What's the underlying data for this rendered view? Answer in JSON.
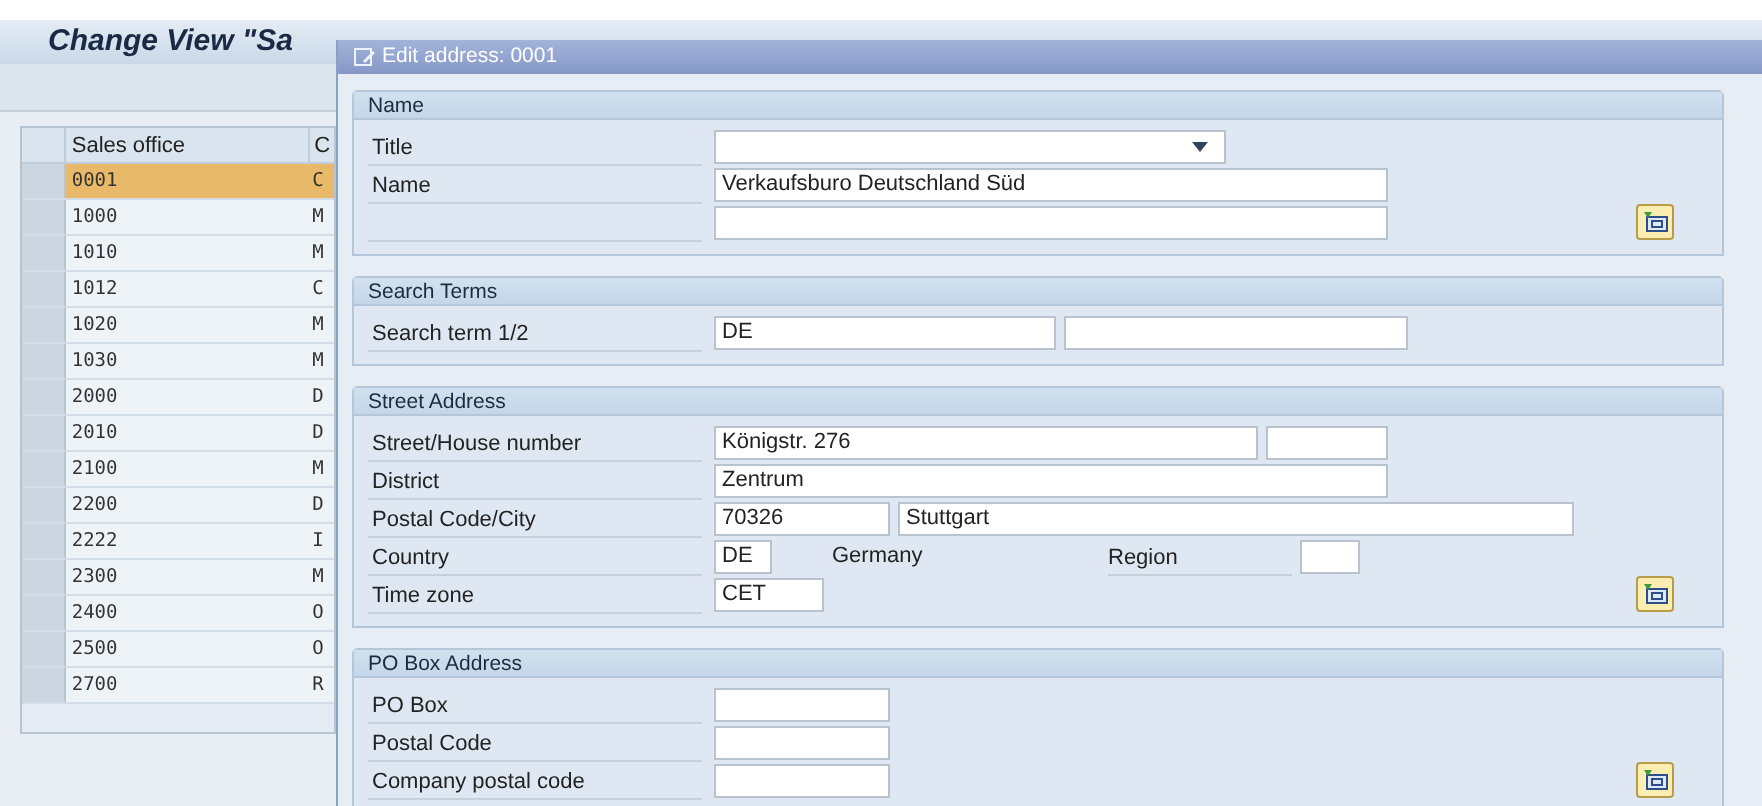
{
  "main_window": {
    "title": "Change View \"Sa",
    "table": {
      "columns": [
        "Sales office",
        "C"
      ],
      "rows": [
        {
          "sales_office": "0001",
          "column_2": "C",
          "selected": true
        },
        {
          "sales_office": "1000",
          "column_2": "M",
          "selected": false
        },
        {
          "sales_office": "1010",
          "column_2": "M",
          "selected": false
        },
        {
          "sales_office": "1012",
          "column_2": "C",
          "selected": false
        },
        {
          "sales_office": "1020",
          "column_2": "M",
          "selected": false
        },
        {
          "sales_office": "1030",
          "column_2": "M",
          "selected": false
        },
        {
          "sales_office": "2000",
          "column_2": "D",
          "selected": false
        },
        {
          "sales_office": "2010",
          "column_2": "D",
          "selected": false
        },
        {
          "sales_office": "2100",
          "column_2": "M",
          "selected": false
        },
        {
          "sales_office": "2200",
          "column_2": "D",
          "selected": false
        },
        {
          "sales_office": "2222",
          "column_2": "I",
          "selected": false
        },
        {
          "sales_office": "2300",
          "column_2": "M",
          "selected": false
        },
        {
          "sales_office": "2400",
          "column_2": "O",
          "selected": false
        },
        {
          "sales_office": "2500",
          "column_2": "O",
          "selected": false
        },
        {
          "sales_office": "2700",
          "column_2": "R",
          "selected": false
        }
      ]
    }
  },
  "dialog": {
    "title": "Edit address: 0001",
    "groups": [
      {
        "title": "Name",
        "detail_button": true,
        "rows": [
          {
            "label": "Title",
            "items": [
              {
                "kind": "dropdown"
              }
            ]
          },
          {
            "label": "Name",
            "items": [
              {
                "kind": "field",
                "value": "Verkaufsburo Deutschland Süd"
              }
            ]
          },
          {
            "items": [
              {
                "kind": "field"
              }
            ]
          }
        ]
      },
      {
        "title": "Search Terms",
        "detail_button": false,
        "rows": [
          {
            "label": "Search term 1/2",
            "items": [
              {
                "kind": "field",
                "value": "DE"
              },
              {
                "kind": "field"
              }
            ]
          }
        ]
      },
      {
        "title": "Street Address",
        "detail_button": true,
        "rows": [
          {
            "label": "Street/House number",
            "items": [
              {
                "kind": "field",
                "value": "Königstr. 276"
              },
              {
                "kind": "field"
              }
            ]
          },
          {
            "label": "District",
            "items": [
              {
                "kind": "field",
                "value": "Zentrum"
              }
            ]
          },
          {
            "label": "Postal Code/City",
            "items": [
              {
                "kind": "field",
                "value": "70326"
              },
              {
                "kind": "field",
                "value": "Stuttgart"
              }
            ]
          },
          {
            "label": "Country",
            "items": [
              {
                "kind": "field",
                "value": "DE"
              },
              {
                "kind": "text",
                "value": "Germany"
              },
              {
                "kind": "label",
                "value": "Region"
              },
              {
                "kind": "field"
              }
            ]
          },
          {
            "label": "Time zone",
            "items": [
              {
                "kind": "field",
                "value": "CET"
              }
            ]
          }
        ]
      },
      {
        "title": "PO Box Address",
        "detail_button": true,
        "rows": [
          {
            "label": "PO Box",
            "items": [
              {
                "kind": "field"
              }
            ]
          },
          {
            "label": "Postal Code",
            "items": [
              {
                "kind": "field"
              }
            ]
          },
          {
            "label": "Company postal code",
            "items": [
              {
                "kind": "field"
              }
            ]
          }
        ]
      }
    ]
  }
}
